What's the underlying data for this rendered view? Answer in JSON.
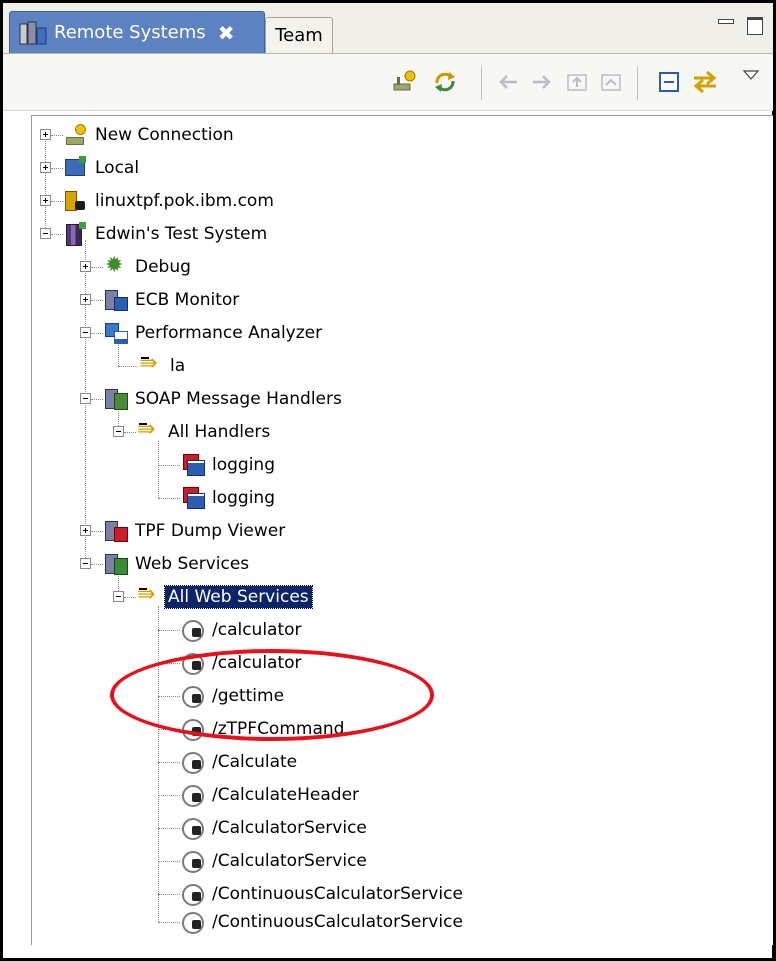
{
  "tabs": {
    "active_label": "Remote Systems",
    "active_close": "✖",
    "inactive_label": "Team"
  },
  "toolbar": {
    "icons": [
      "new-connection-icon",
      "refresh-icon",
      "back-icon",
      "forward-icon",
      "home-icon",
      "collapse-all-icon",
      "link-with-editor-icon",
      "view-menu-icon"
    ]
  },
  "tree": {
    "new_connection": "New Connection",
    "local": "Local",
    "linux": "linuxtpf.pok.ibm.com",
    "edwin": "Edwin's Test System",
    "debug": "Debug",
    "ecb": "ECB Monitor",
    "perf": "Performance Analyzer",
    "la": "la",
    "soap": "SOAP Message Handlers",
    "all_handlers": "All Handlers",
    "logging1": "logging",
    "logging2": "logging",
    "dump": "TPF Dump Viewer",
    "web": "Web Services",
    "all_web": "All Web Services",
    "services": [
      "/calculator",
      "/calculator",
      "/gettime",
      "/zTPFCommand",
      "/Calculate",
      "/CalculateHeader",
      "/CalculatorService",
      "/CalculatorService",
      "/ContinuousCalculatorService",
      "/ContinuousCalculatorService"
    ]
  },
  "colors": {
    "active_tab": "#5d82c2",
    "selection": "#0a246a",
    "annotation": "#e8101a"
  }
}
